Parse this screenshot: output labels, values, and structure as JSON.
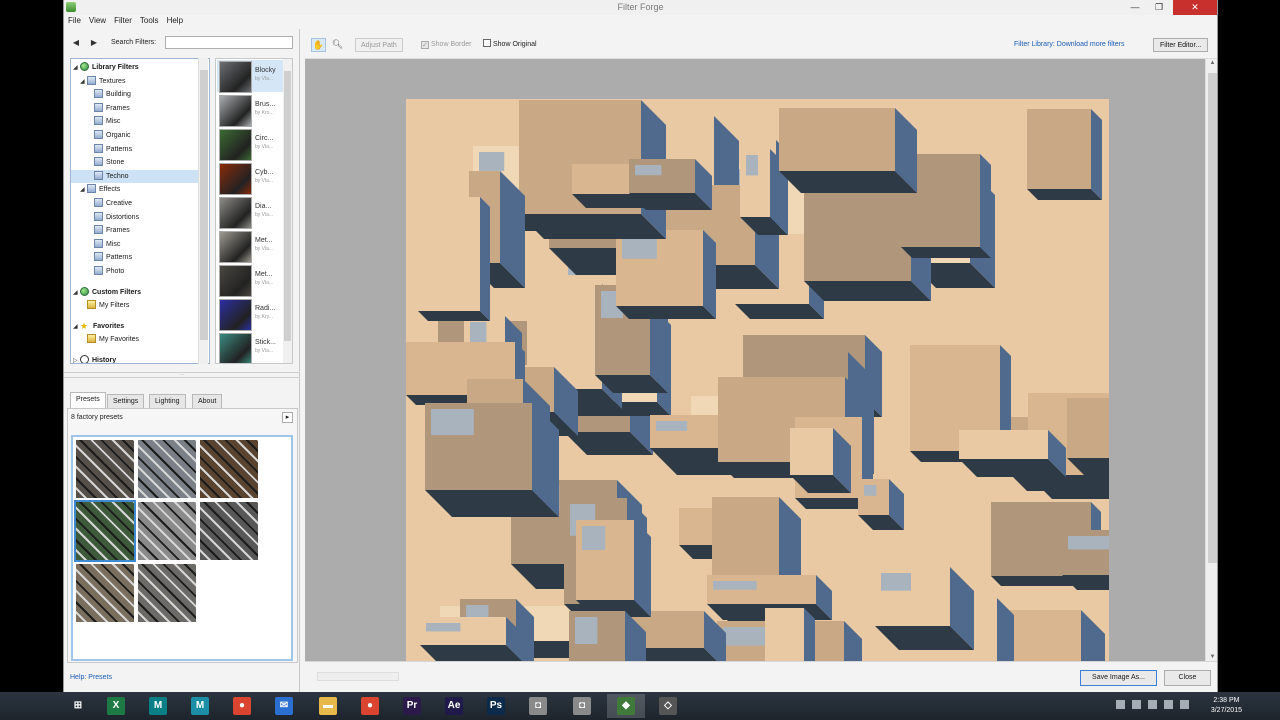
{
  "window": {
    "title": "Filter Forge"
  },
  "menu": [
    "File",
    "View",
    "Filter",
    "Tools",
    "Help"
  ],
  "nav": {
    "search_label": "Search Filters:",
    "search_value": ""
  },
  "tree": [
    {
      "label": "Library Filters",
      "indent": 0,
      "icon": "globe",
      "expand": "open",
      "bold": true
    },
    {
      "label": "Textures",
      "indent": 1,
      "icon": "box",
      "expand": "open"
    },
    {
      "label": "Building",
      "indent": 2,
      "icon": "box"
    },
    {
      "label": "Frames",
      "indent": 2,
      "icon": "box"
    },
    {
      "label": "Misc",
      "indent": 2,
      "icon": "box"
    },
    {
      "label": "Organic",
      "indent": 2,
      "icon": "box"
    },
    {
      "label": "Patterns",
      "indent": 2,
      "icon": "box"
    },
    {
      "label": "Stone",
      "indent": 2,
      "icon": "box"
    },
    {
      "label": "Techno",
      "indent": 2,
      "icon": "box",
      "selected": true
    },
    {
      "label": "Effects",
      "indent": 1,
      "icon": "box",
      "expand": "open"
    },
    {
      "label": "Creative",
      "indent": 2,
      "icon": "box"
    },
    {
      "label": "Distortions",
      "indent": 2,
      "icon": "box"
    },
    {
      "label": "Frames",
      "indent": 2,
      "icon": "box"
    },
    {
      "label": "Misc",
      "indent": 2,
      "icon": "box"
    },
    {
      "label": "Patterns",
      "indent": 2,
      "icon": "box"
    },
    {
      "label": "Photo",
      "indent": 2,
      "icon": "box"
    },
    {
      "label": "Custom Filters",
      "indent": 0,
      "icon": "globe",
      "expand": "open",
      "bold": true,
      "gap": true
    },
    {
      "label": "My Filters",
      "indent": 1,
      "icon": "folder"
    },
    {
      "label": "Favorites",
      "indent": 0,
      "icon": "star",
      "expand": "open",
      "bold": true,
      "gap": true
    },
    {
      "label": "My Favorites",
      "indent": 1,
      "icon": "folder"
    },
    {
      "label": "History",
      "indent": 0,
      "icon": "hist",
      "expand": "closed",
      "bold": true,
      "gap": true
    }
  ],
  "filter_list": [
    {
      "name": "Blocky",
      "by": "by Vla...",
      "thumb": "#6b6f73",
      "selected": true
    },
    {
      "name": "Brus...",
      "by": "by Kro...",
      "thumb": "#a9adb0"
    },
    {
      "name": "Circ...",
      "by": "by Vla...",
      "thumb": "#3b6b32"
    },
    {
      "name": "Cyb...",
      "by": "by Vla...",
      "thumb": "#8a2a0a"
    },
    {
      "name": "Dia...",
      "by": "by Vla...",
      "thumb": "#8c8b86"
    },
    {
      "name": "Met...",
      "by": "by Vla...",
      "thumb": "#9d9a90"
    },
    {
      "name": "Met...",
      "by": "by Vla...",
      "thumb": "#4a4740"
    },
    {
      "name": "Radi...",
      "by": "by Kry...",
      "thumb": "#2b2fa3"
    },
    {
      "name": "Stick...",
      "by": "by Vla...",
      "thumb": "#3a8a80"
    }
  ],
  "tabs": [
    "Presets",
    "Settings",
    "Lighting",
    "About"
  ],
  "presets": {
    "count_label": "8 factory presets",
    "tiles": [
      {
        "color": "#55514a",
        "selected": false
      },
      {
        "color": "#7b8088",
        "selected": false
      },
      {
        "color": "#5a4430",
        "selected": false
      },
      {
        "color": "#3d5a3a",
        "selected": true
      },
      {
        "color": "#8a8a8a",
        "selected": false
      },
      {
        "color": "#585858",
        "selected": false
      },
      {
        "color": "#7a6e5e",
        "selected": false
      },
      {
        "color": "#6c6a66",
        "selected": false
      }
    ],
    "help_label": "Help: Presets"
  },
  "toolbar": {
    "adjust_path": "Adjust Path",
    "show_border": "Show Border",
    "show_original": "Show Original",
    "library_link": "Filter Library: Download more filters",
    "filter_editor": "Filter Editor..."
  },
  "footer": {
    "save": "Save Image As...",
    "close": "Close"
  },
  "colors": {
    "render_light": "#e8c9a3",
    "render_mid": "#b0967a",
    "render_blue": "#4f6a8c",
    "render_dark": "#2f3a47",
    "accent_close": "#c7302c"
  },
  "taskbar": {
    "apps": [
      {
        "name": "windows-start",
        "glyph": "⊞",
        "bg": "transparent"
      },
      {
        "name": "excel",
        "glyph": "X",
        "bg": "#1d7a44"
      },
      {
        "name": "app-teal-1",
        "glyph": "M",
        "bg": "#0a7f86"
      },
      {
        "name": "app-teal-2",
        "glyph": "M",
        "bg": "#1b8fa6"
      },
      {
        "name": "chrome",
        "glyph": "●",
        "bg": "#d9452f"
      },
      {
        "name": "mail",
        "glyph": "✉",
        "bg": "#2b6fd0"
      },
      {
        "name": "file-explorer",
        "glyph": "▬",
        "bg": "#e7b84a"
      },
      {
        "name": "chrome-2",
        "glyph": "●",
        "bg": "#d9452f"
      },
      {
        "name": "premiere",
        "glyph": "Pr",
        "bg": "#2b1a4a"
      },
      {
        "name": "after-effects",
        "glyph": "Ae",
        "bg": "#1f1a4a"
      },
      {
        "name": "photoshop",
        "glyph": "Ps",
        "bg": "#0c2a4a"
      },
      {
        "name": "app-pin-1",
        "glyph": "◘",
        "bg": "#8a8a8a"
      },
      {
        "name": "app-pin-2",
        "glyph": "◘",
        "bg": "#8a8a8a"
      },
      {
        "name": "filter-forge",
        "glyph": "◆",
        "bg": "#3f7a3a"
      },
      {
        "name": "app-pin-3",
        "glyph": "◇",
        "bg": "#555"
      }
    ],
    "time": "2:38 PM",
    "date": "3/27/2015"
  }
}
